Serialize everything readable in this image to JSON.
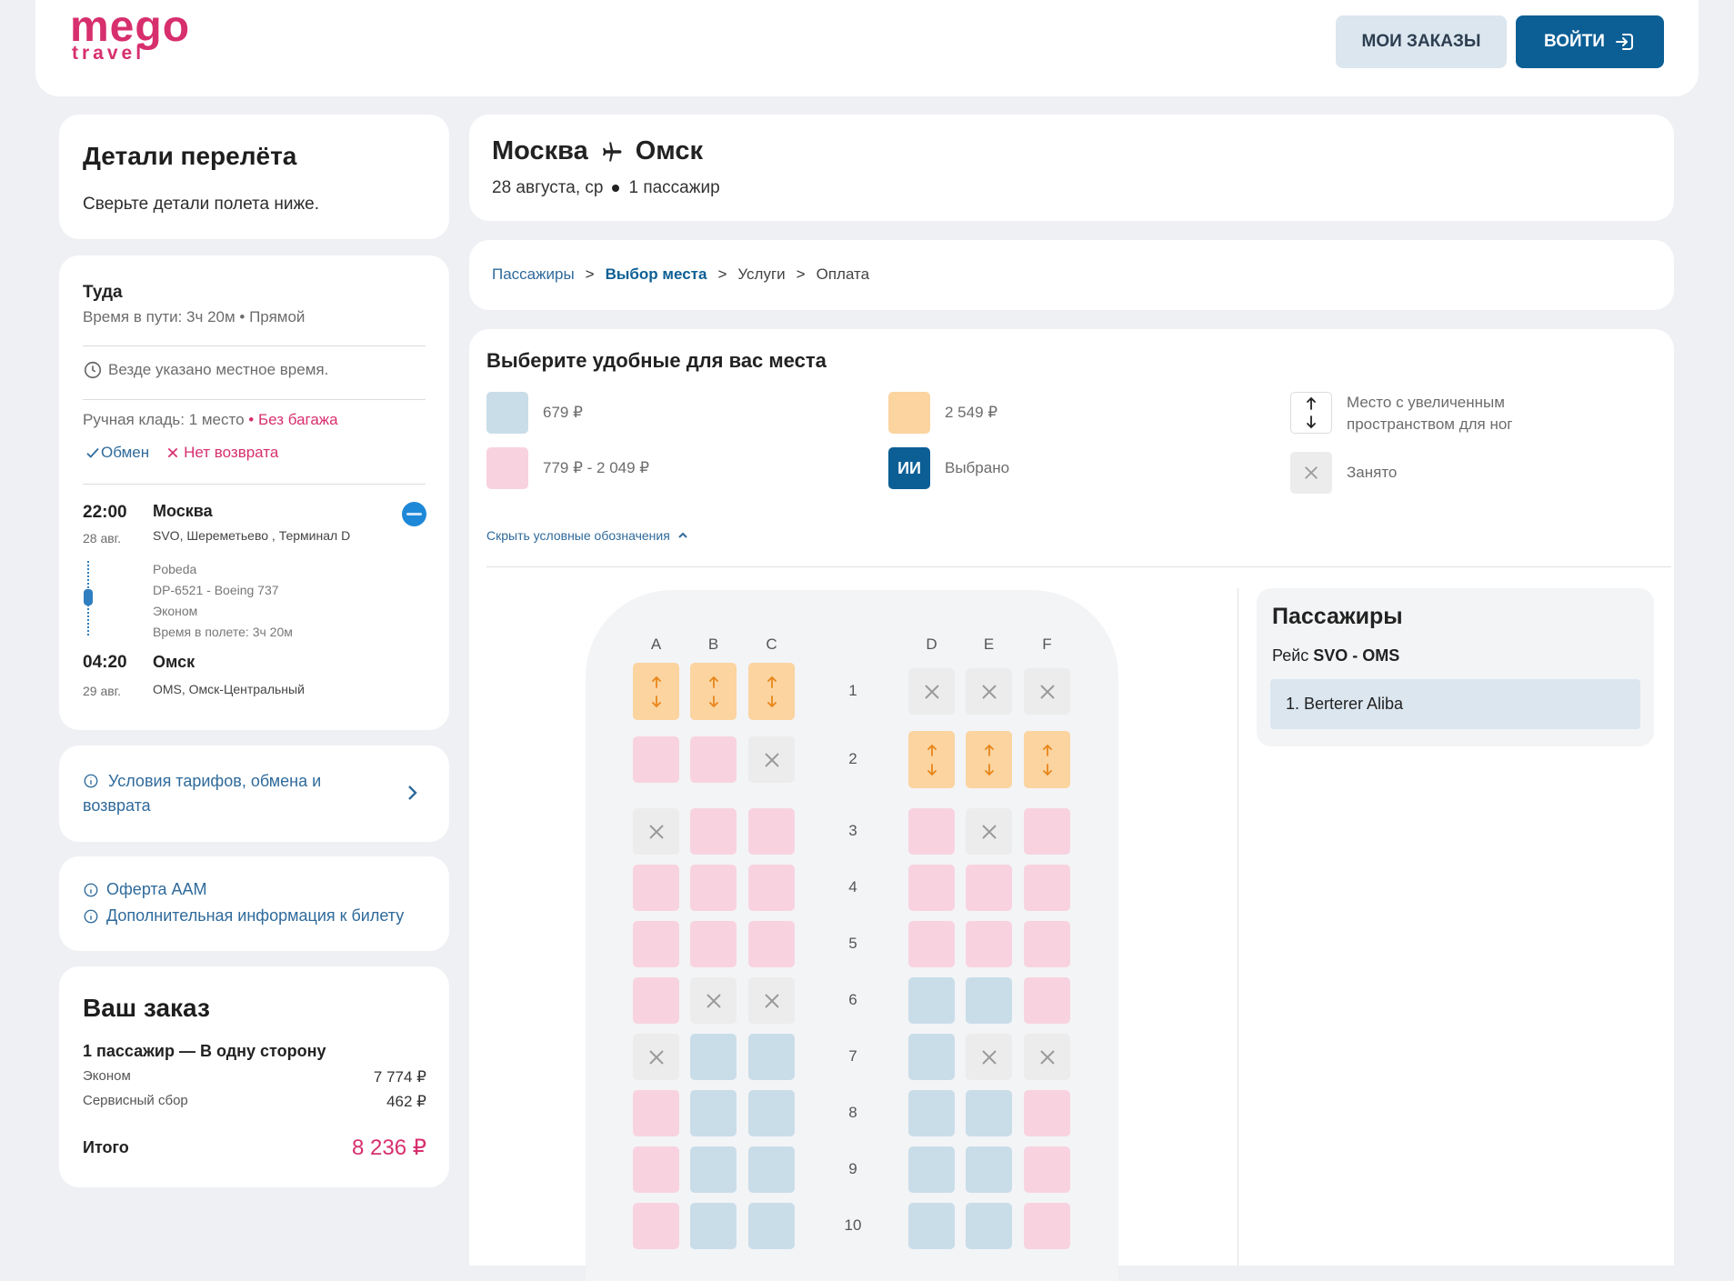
{
  "header": {
    "logo_top": "mego",
    "logo_bottom": "travel",
    "orders_label": "МОИ ЗАКАЗЫ",
    "login_label": "ВОЙТИ"
  },
  "details": {
    "title": "Детали перелёта",
    "subtitle": "Сверьте детали полета ниже."
  },
  "trip": {
    "direction": "Туда",
    "duration": "Время в пути: 3ч 20м • Прямой",
    "local_time_note": "Везде указано местное время.",
    "hand_luggage": "Ручная кладь: 1 место",
    "no_baggage": "• Без багажа",
    "exchange": "Обмен",
    "no_refund": "Нет возврата",
    "dep_time": "22:00",
    "dep_date": "28 авг.",
    "dep_city": "Москва",
    "dep_airport": "SVO, Шереметьево , Терминал D",
    "airline": "Pobeda",
    "flight": "DP-6521 - Boeing 737",
    "cabin": "Эконом",
    "flight_time": "Время в полете: 3ч 20м",
    "arr_time": "04:20",
    "arr_date": "29 авг.",
    "arr_city": "Омск",
    "arr_airport": "OMS, Омск-Центральный"
  },
  "tariff_conditions": {
    "label_line1": "Условия тарифов, обмена и",
    "label_line2": "возврата"
  },
  "offers": {
    "offer": "Оферта ААМ",
    "extra_info": "Дополнительная информация к билету"
  },
  "order": {
    "title": "Ваш заказ",
    "summary": "1 пассажир — В одну сторону",
    "items": [
      {
        "label": "Эконом",
        "value": "7 774 ₽"
      },
      {
        "label": "Сервисный сбор",
        "value": "462 ₽"
      }
    ],
    "total_label": "Итого",
    "total_value": "8 236 ₽"
  },
  "route": {
    "from": "Москва",
    "to": "Омск",
    "date_info": "28 августа, ср",
    "passengers": "1 пассажир"
  },
  "breadcrumb": [
    "Пассажиры",
    "Выбор места",
    "Услуги",
    "Оплата"
  ],
  "seat_select": {
    "title": "Выберите удобные для вас места",
    "legend": {
      "blue": "679 ₽",
      "orange": "2 549 ₽",
      "extra_legroom_line1": "Место с увеличенным",
      "extra_legroom_line2": "пространством для ног",
      "pink": "779 ₽ - 2 049 ₽",
      "selected_initials": "ИИ",
      "selected": "Выбрано",
      "taken": "Занято"
    },
    "hide_legend": "Скрыть условные обозначения",
    "columns": [
      "A",
      "B",
      "C",
      "D",
      "E",
      "F"
    ],
    "rows": [
      {
        "num": "1",
        "seats": [
          "orange",
          "orange",
          "orange",
          "taken",
          "taken",
          "taken"
        ]
      },
      {
        "num": "2",
        "seats": [
          "pink",
          "pink",
          "taken",
          "orange",
          "orange",
          "orange"
        ]
      },
      {
        "num": "3",
        "seats": [
          "taken",
          "pink",
          "pink",
          "pink",
          "taken",
          "pink"
        ]
      },
      {
        "num": "4",
        "seats": [
          "pink",
          "pink",
          "pink",
          "pink",
          "pink",
          "pink"
        ]
      },
      {
        "num": "5",
        "seats": [
          "pink",
          "pink",
          "pink",
          "pink",
          "pink",
          "pink"
        ]
      },
      {
        "num": "6",
        "seats": [
          "pink",
          "taken",
          "taken",
          "blue",
          "blue",
          "pink"
        ]
      },
      {
        "num": "7",
        "seats": [
          "taken",
          "blue",
          "blue",
          "blue",
          "taken",
          "taken"
        ]
      },
      {
        "num": "8",
        "seats": [
          "pink",
          "blue",
          "blue",
          "blue",
          "blue",
          "pink"
        ]
      },
      {
        "num": "9",
        "seats": [
          "pink",
          "blue",
          "blue",
          "blue",
          "blue",
          "pink"
        ]
      },
      {
        "num": "10",
        "seats": [
          "pink",
          "blue",
          "blue",
          "blue",
          "blue",
          "pink"
        ]
      }
    ]
  },
  "passengers_panel": {
    "title": "Пассажиры",
    "flight_prefix": "Рейс",
    "flight_route": "SVO - OMS",
    "passenger": "1. Berterer Aliba"
  },
  "colors": {
    "brand": "#d72f6e",
    "primary": "#0c5f95",
    "seat_blue": "#c9dde9",
    "seat_pink": "#f8d3df",
    "seat_orange": "#fbd4a0",
    "seat_taken": "#ececec",
    "total": "#d72f6e"
  }
}
